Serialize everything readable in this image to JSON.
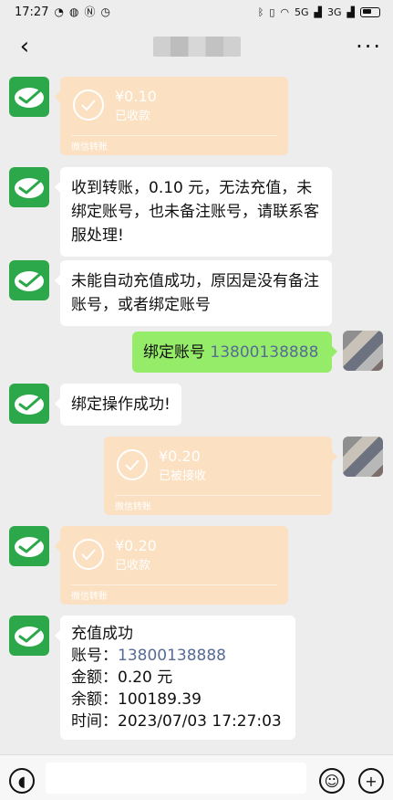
{
  "status_bar": {
    "time": "17:27",
    "signal_labels": [
      "5G",
      "3G"
    ]
  },
  "nav": {
    "back_icon": "back-chevron-icon",
    "more_icon": "more-dots-icon"
  },
  "messages": {
    "transfer_1": {
      "amount": "¥0.10",
      "status": "已收款",
      "footer": "微信转账"
    },
    "text_1": "收到转账，0.10 元，无法充值，未绑定账号，也未备注账号，请联系客服处理!",
    "text_2": "未能自动充值成功，原因是没有备注账号，或者绑定账号",
    "me_1_prefix": "绑定账号 ",
    "me_1_phone": "13800138888",
    "text_3": "绑定操作成功!",
    "transfer_2": {
      "amount": "¥0.20",
      "status": "已被接收",
      "footer": "微信转账"
    },
    "transfer_3": {
      "amount": "¥0.20",
      "status": "已收款",
      "footer": "微信转账"
    },
    "receipt": {
      "title": "充值成功",
      "account_label": "账号：",
      "account_value": "13800138888",
      "amount_label": "金额：",
      "amount_value": "0.20 元",
      "balance_label": "余额：",
      "balance_value": "100189.39",
      "time_label": "时间：",
      "time_value": "2023/07/03 17:27:03"
    }
  },
  "colors": {
    "background": "#ededed",
    "bubble_self": "#95ec69",
    "transfer_bg": "#fbe0c2",
    "avatar_green": "#2ca84a",
    "link_blue": "#576b95"
  }
}
